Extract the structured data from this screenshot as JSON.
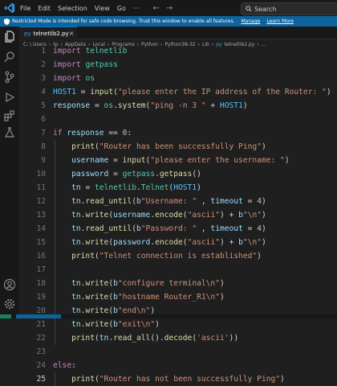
{
  "menu": [
    "File",
    "Edit",
    "Selection",
    "View",
    "Go"
  ],
  "search": {
    "label": "Search"
  },
  "banner": {
    "text": "Restricted Mode is intended for safe code browsing. Trust this window to enable all features.",
    "manage": "Manage",
    "learn_more": "Learn More"
  },
  "tab": {
    "icon_text": "py",
    "filename": "telnetlib2.py"
  },
  "breadcrumbs": [
    "C: \\ Users",
    "tp",
    "AppData",
    "Local",
    "Programs",
    "Python",
    "Python38-32",
    "Lib",
    "telnetlib2.py",
    "..."
  ],
  "lines": [
    {
      "n": "1",
      "tokens": [
        [
          "kw",
          "import "
        ],
        [
          "mod",
          "telnetlib"
        ]
      ]
    },
    {
      "n": "2",
      "tokens": [
        [
          "kw",
          "import "
        ],
        [
          "mod",
          "getpass"
        ]
      ]
    },
    {
      "n": "3",
      "tokens": [
        [
          "kw",
          "import "
        ],
        [
          "mod",
          "os"
        ]
      ]
    },
    {
      "n": "4",
      "tokens": [
        [
          "cst",
          "HOST1"
        ],
        [
          "op",
          " = "
        ],
        [
          "fn",
          "input"
        ],
        [
          "pl",
          "("
        ],
        [
          "str",
          "\"please enter the IP address of the Router: \""
        ],
        [
          "pl",
          ")"
        ]
      ]
    },
    {
      "n": "5",
      "tokens": [
        [
          "var",
          "response"
        ],
        [
          "op",
          " = "
        ],
        [
          "mod",
          "os"
        ],
        [
          "pl",
          "."
        ],
        [
          "fn",
          "system"
        ],
        [
          "pl",
          "("
        ],
        [
          "str",
          "\"ping -n 3 \""
        ],
        [
          "op",
          " + "
        ],
        [
          "cst",
          "HOST1"
        ],
        [
          "pl",
          ")"
        ]
      ]
    },
    {
      "n": "6",
      "tokens": []
    },
    {
      "n": "7",
      "tokens": [
        [
          "kw",
          "if "
        ],
        [
          "var",
          "response"
        ],
        [
          "op",
          " == "
        ],
        [
          "num",
          "0"
        ],
        [
          "pl",
          ":"
        ]
      ]
    },
    {
      "n": "8",
      "tokens": [
        [
          "pl",
          "    "
        ],
        [
          "fn",
          "print"
        ],
        [
          "pl",
          "("
        ],
        [
          "str",
          "\"Router has been successfully Ping\""
        ],
        [
          "pl",
          ")"
        ]
      ]
    },
    {
      "n": "9",
      "tokens": [
        [
          "pl",
          "    "
        ],
        [
          "var",
          "username"
        ],
        [
          "op",
          " = "
        ],
        [
          "fn",
          "input"
        ],
        [
          "pl",
          "("
        ],
        [
          "str",
          "\"please enter the username: \""
        ],
        [
          "pl",
          ")"
        ]
      ]
    },
    {
      "n": "10",
      "tokens": [
        [
          "pl",
          "    "
        ],
        [
          "var",
          "password"
        ],
        [
          "op",
          " = "
        ],
        [
          "mod",
          "getpass"
        ],
        [
          "pl",
          "."
        ],
        [
          "fn",
          "getpass"
        ],
        [
          "pl",
          "()"
        ]
      ]
    },
    {
      "n": "11",
      "tokens": [
        [
          "pl",
          "    "
        ],
        [
          "var",
          "tn"
        ],
        [
          "op",
          " = "
        ],
        [
          "mod",
          "telnetlib"
        ],
        [
          "pl",
          "."
        ],
        [
          "mod",
          "Telnet"
        ],
        [
          "pl",
          "("
        ],
        [
          "cst",
          "HOST1"
        ],
        [
          "pl",
          ")"
        ]
      ]
    },
    {
      "n": "12",
      "tokens": [
        [
          "pl",
          "    "
        ],
        [
          "var",
          "tn"
        ],
        [
          "pl",
          "."
        ],
        [
          "fn",
          "read_until"
        ],
        [
          "pl",
          "("
        ],
        [
          "var",
          "b"
        ],
        [
          "str",
          "\"Username: \""
        ],
        [
          "pl",
          " , "
        ],
        [
          "var",
          "timeout"
        ],
        [
          "op",
          " = "
        ],
        [
          "num",
          "4"
        ],
        [
          "pl",
          ")"
        ]
      ]
    },
    {
      "n": "13",
      "tokens": [
        [
          "pl",
          "    "
        ],
        [
          "var",
          "tn"
        ],
        [
          "pl",
          "."
        ],
        [
          "fn",
          "write"
        ],
        [
          "pl",
          "("
        ],
        [
          "var",
          "username"
        ],
        [
          "pl",
          "."
        ],
        [
          "fn",
          "encode"
        ],
        [
          "pl",
          "("
        ],
        [
          "str",
          "\"ascii\""
        ],
        [
          "pl",
          ") "
        ],
        [
          "op",
          "+ "
        ],
        [
          "var",
          "b"
        ],
        [
          "str",
          "\"\\n\""
        ],
        [
          "pl",
          ")"
        ]
      ]
    },
    {
      "n": "14",
      "tokens": [
        [
          "pl",
          "    "
        ],
        [
          "var",
          "tn"
        ],
        [
          "pl",
          "."
        ],
        [
          "fn",
          "read_until"
        ],
        [
          "pl",
          "("
        ],
        [
          "var",
          "b"
        ],
        [
          "str",
          "\"Password: \""
        ],
        [
          "pl",
          " , "
        ],
        [
          "var",
          "timeout"
        ],
        [
          "op",
          " = "
        ],
        [
          "num",
          "4"
        ],
        [
          "pl",
          ")"
        ]
      ]
    },
    {
      "n": "15",
      "tokens": [
        [
          "pl",
          "    "
        ],
        [
          "var",
          "tn"
        ],
        [
          "pl",
          "."
        ],
        [
          "fn",
          "write"
        ],
        [
          "pl",
          "("
        ],
        [
          "var",
          "password"
        ],
        [
          "pl",
          "."
        ],
        [
          "fn",
          "encode"
        ],
        [
          "pl",
          "("
        ],
        [
          "str",
          "\"ascii\""
        ],
        [
          "pl",
          ") "
        ],
        [
          "op",
          "+ "
        ],
        [
          "var",
          "b"
        ],
        [
          "str",
          "\"\\n\""
        ],
        [
          "pl",
          ")"
        ]
      ]
    },
    {
      "n": "16",
      "tokens": [
        [
          "pl",
          "    "
        ],
        [
          "fn",
          "print"
        ],
        [
          "pl",
          "("
        ],
        [
          "str",
          "\"Telnet connection is established\""
        ],
        [
          "pl",
          ")"
        ]
      ]
    },
    {
      "n": "17",
      "tokens": []
    },
    {
      "n": "18",
      "tokens": [
        [
          "pl",
          "    "
        ],
        [
          "var",
          "tn"
        ],
        [
          "pl",
          "."
        ],
        [
          "fn",
          "write"
        ],
        [
          "pl",
          "("
        ],
        [
          "var",
          "b"
        ],
        [
          "str",
          "\"configure terminal\\n\""
        ],
        [
          "pl",
          ")"
        ]
      ]
    },
    {
      "n": "19",
      "tokens": [
        [
          "pl",
          "    "
        ],
        [
          "var",
          "tn"
        ],
        [
          "pl",
          "."
        ],
        [
          "fn",
          "write"
        ],
        [
          "pl",
          "("
        ],
        [
          "var",
          "b"
        ],
        [
          "str",
          "\"hostname Router_R1\\n\""
        ],
        [
          "pl",
          ")"
        ]
      ]
    },
    {
      "n": "20",
      "tokens": [
        [
          "pl",
          "    "
        ],
        [
          "var",
          "tn"
        ],
        [
          "pl",
          "."
        ],
        [
          "fn",
          "write"
        ],
        [
          "pl",
          "("
        ],
        [
          "var",
          "b"
        ],
        [
          "str",
          "\"end\\n\""
        ],
        [
          "pl",
          ")"
        ]
      ]
    },
    {
      "n": "21",
      "tokens": [
        [
          "pl",
          "    "
        ],
        [
          "var",
          "tn"
        ],
        [
          "pl",
          "."
        ],
        [
          "fn",
          "write"
        ],
        [
          "pl",
          "("
        ],
        [
          "var",
          "b"
        ],
        [
          "str",
          "\"exit\\n\""
        ],
        [
          "pl",
          ")"
        ]
      ]
    },
    {
      "n": "22",
      "tokens": [
        [
          "pl",
          "    "
        ],
        [
          "fn",
          "print"
        ],
        [
          "pl",
          "("
        ],
        [
          "var",
          "tn"
        ],
        [
          "pl",
          "."
        ],
        [
          "fn",
          "read_all"
        ],
        [
          "pl",
          "()."
        ],
        [
          "fn",
          "decode"
        ],
        [
          "pl",
          "("
        ],
        [
          "str",
          "'ascii'"
        ],
        [
          "pl",
          "))"
        ]
      ]
    },
    {
      "n": "23",
      "tokens": []
    },
    {
      "n": "24",
      "tokens": [
        [
          "kw",
          "else"
        ],
        [
          "pl",
          ":"
        ]
      ]
    },
    {
      "n": "25",
      "tokens": [
        [
          "pl",
          "    "
        ],
        [
          "fn",
          "print"
        ],
        [
          "pl",
          "("
        ],
        [
          "str",
          "\"Router has not been successfully Ping\""
        ],
        [
          "pl",
          ")"
        ]
      ]
    }
  ],
  "active_line": "25",
  "colors": {
    "accent": "#0078d4",
    "banner": "#0e639c"
  }
}
